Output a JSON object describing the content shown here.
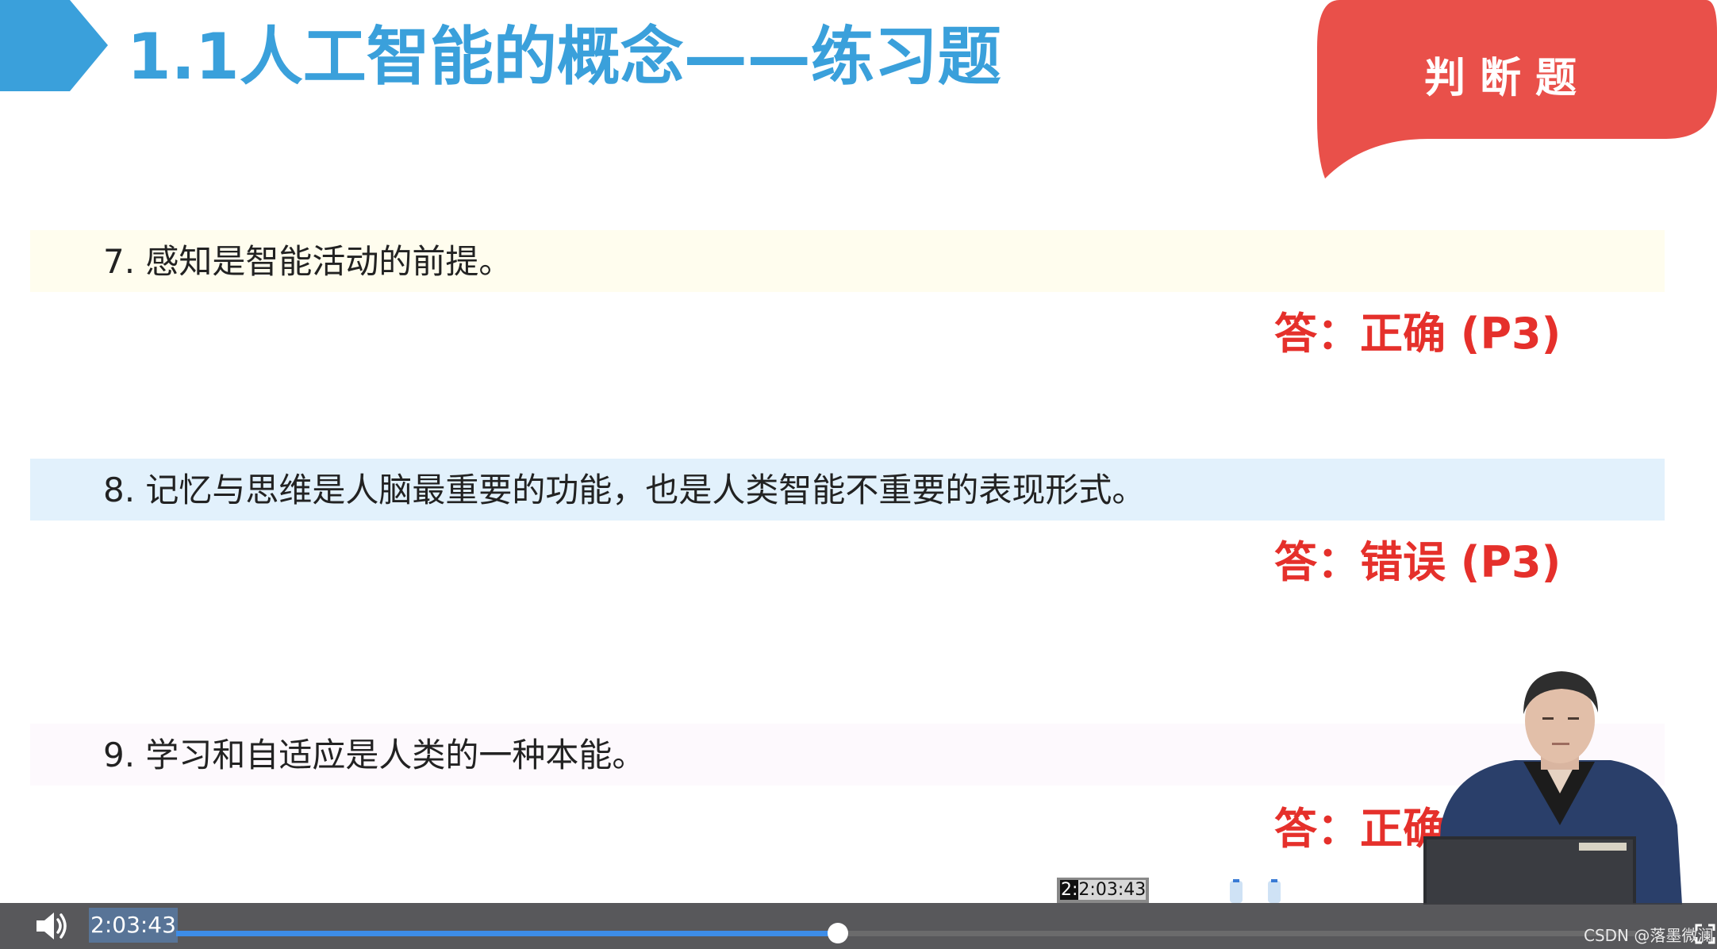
{
  "slide": {
    "title": "1.1人工智能的概念——练习题",
    "badge": "判断题",
    "questions": [
      {
        "text": "7. 感知是智能活动的前提。",
        "answer": "答：正确 (P3)"
      },
      {
        "text": "8. 记忆与思维是人脑最重要的功能，也是人类智能不重要的表现形式。",
        "answer": "答：错误 (P3)"
      },
      {
        "text": "9. 学习和自适应是人类的一种本能。",
        "answer": "答：正确"
      }
    ]
  },
  "player": {
    "current_time": "2:03:43",
    "hover_time_highlight": "2:",
    "hover_time_rest": "2:03:43",
    "progress_fraction": 0.4535,
    "volume_icon": "speaker-volume-icon",
    "fullscreen_icon": "fullscreen-icon"
  },
  "watermark": "CSDN @落墨微澜",
  "colors": {
    "title_blue": "#3aa0db",
    "answer_red": "#e5302b",
    "badge_red": "#e9504a",
    "progress_blue": "#3d8de8"
  }
}
